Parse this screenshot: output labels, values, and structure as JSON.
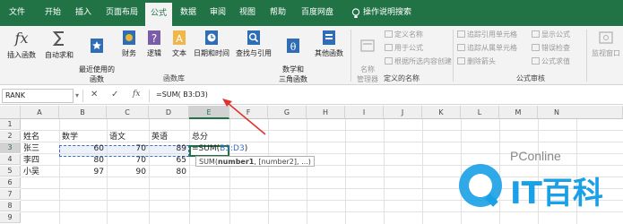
{
  "ribbon_tabs": [
    {
      "label": "文件"
    },
    {
      "label": "开始"
    },
    {
      "label": "插入"
    },
    {
      "label": "页面布局"
    },
    {
      "label": "公式"
    },
    {
      "label": "数据"
    },
    {
      "label": "审阅"
    },
    {
      "label": "视图"
    },
    {
      "label": "帮助"
    },
    {
      "label": "百度网盘"
    }
  ],
  "search_hint": "操作说明搜索",
  "ribbon": {
    "fx_icon": "fx",
    "insert_function": "插入函数",
    "autosum": "自动求和",
    "recent": "最近使用的\n函数",
    "financial": "财务",
    "logical": "逻辑",
    "text": "文本",
    "datetime": "日期和时间",
    "lookup": "查找与引用",
    "math": "数学和\n三角函数",
    "more": "其他函数",
    "library_group": "函数库",
    "name_manager": "名称\n管理器",
    "define_name": "定义名称",
    "use_in_formula": "用于公式",
    "create_from_sel": "根据所选内容创建",
    "names_group": "定义的名称",
    "trace_precedents": "追踪引用单元格",
    "trace_dependents": "追踪从属单元格",
    "remove_arrows": "删除箭头",
    "show_formulas": "显示公式",
    "error_checking": "错误检查",
    "evaluate_formula": "公式求值",
    "audit_group": "公式审核",
    "watch_window": "监视窗口"
  },
  "formula_bar": {
    "name_box": "RANK",
    "cancel": "✕",
    "enter": "✓",
    "fx": "fx",
    "formula": "=SUM( B3:D3)"
  },
  "sheet": {
    "columns": [
      "A",
      "B",
      "C",
      "D",
      "E",
      "F",
      "G",
      "H",
      "I",
      "J",
      "K",
      "L",
      "M",
      "N"
    ],
    "rows": [
      "1",
      "2",
      "3",
      "4",
      "5",
      "6",
      "7",
      "8",
      "9"
    ],
    "headers": [
      "姓名",
      "数学",
      "语文",
      "英语",
      "总分"
    ],
    "data": [
      {
        "name": "张三",
        "math": "60",
        "chinese": "70",
        "english": "89"
      },
      {
        "name": "李四",
        "math": "80",
        "chinese": "70",
        "english": "65"
      },
      {
        "name": "小吴",
        "math": "97",
        "chinese": "90",
        "english": "80"
      }
    ],
    "edit_prefix": "=SUM(",
    "edit_ref": "B3:D3",
    "edit_suffix": ")",
    "tooltip_fn": "SUM(",
    "tooltip_arg1": "number1",
    "tooltip_rest": ", [number2], ...)"
  },
  "watermark": {
    "brand": "PConline",
    "text": "IT百科"
  },
  "colors": {
    "excel_green": "#217346",
    "annotation_red": "#e0322d",
    "ref_blue": "#3b6fc4",
    "wm_blue": "#1aa0e6"
  }
}
